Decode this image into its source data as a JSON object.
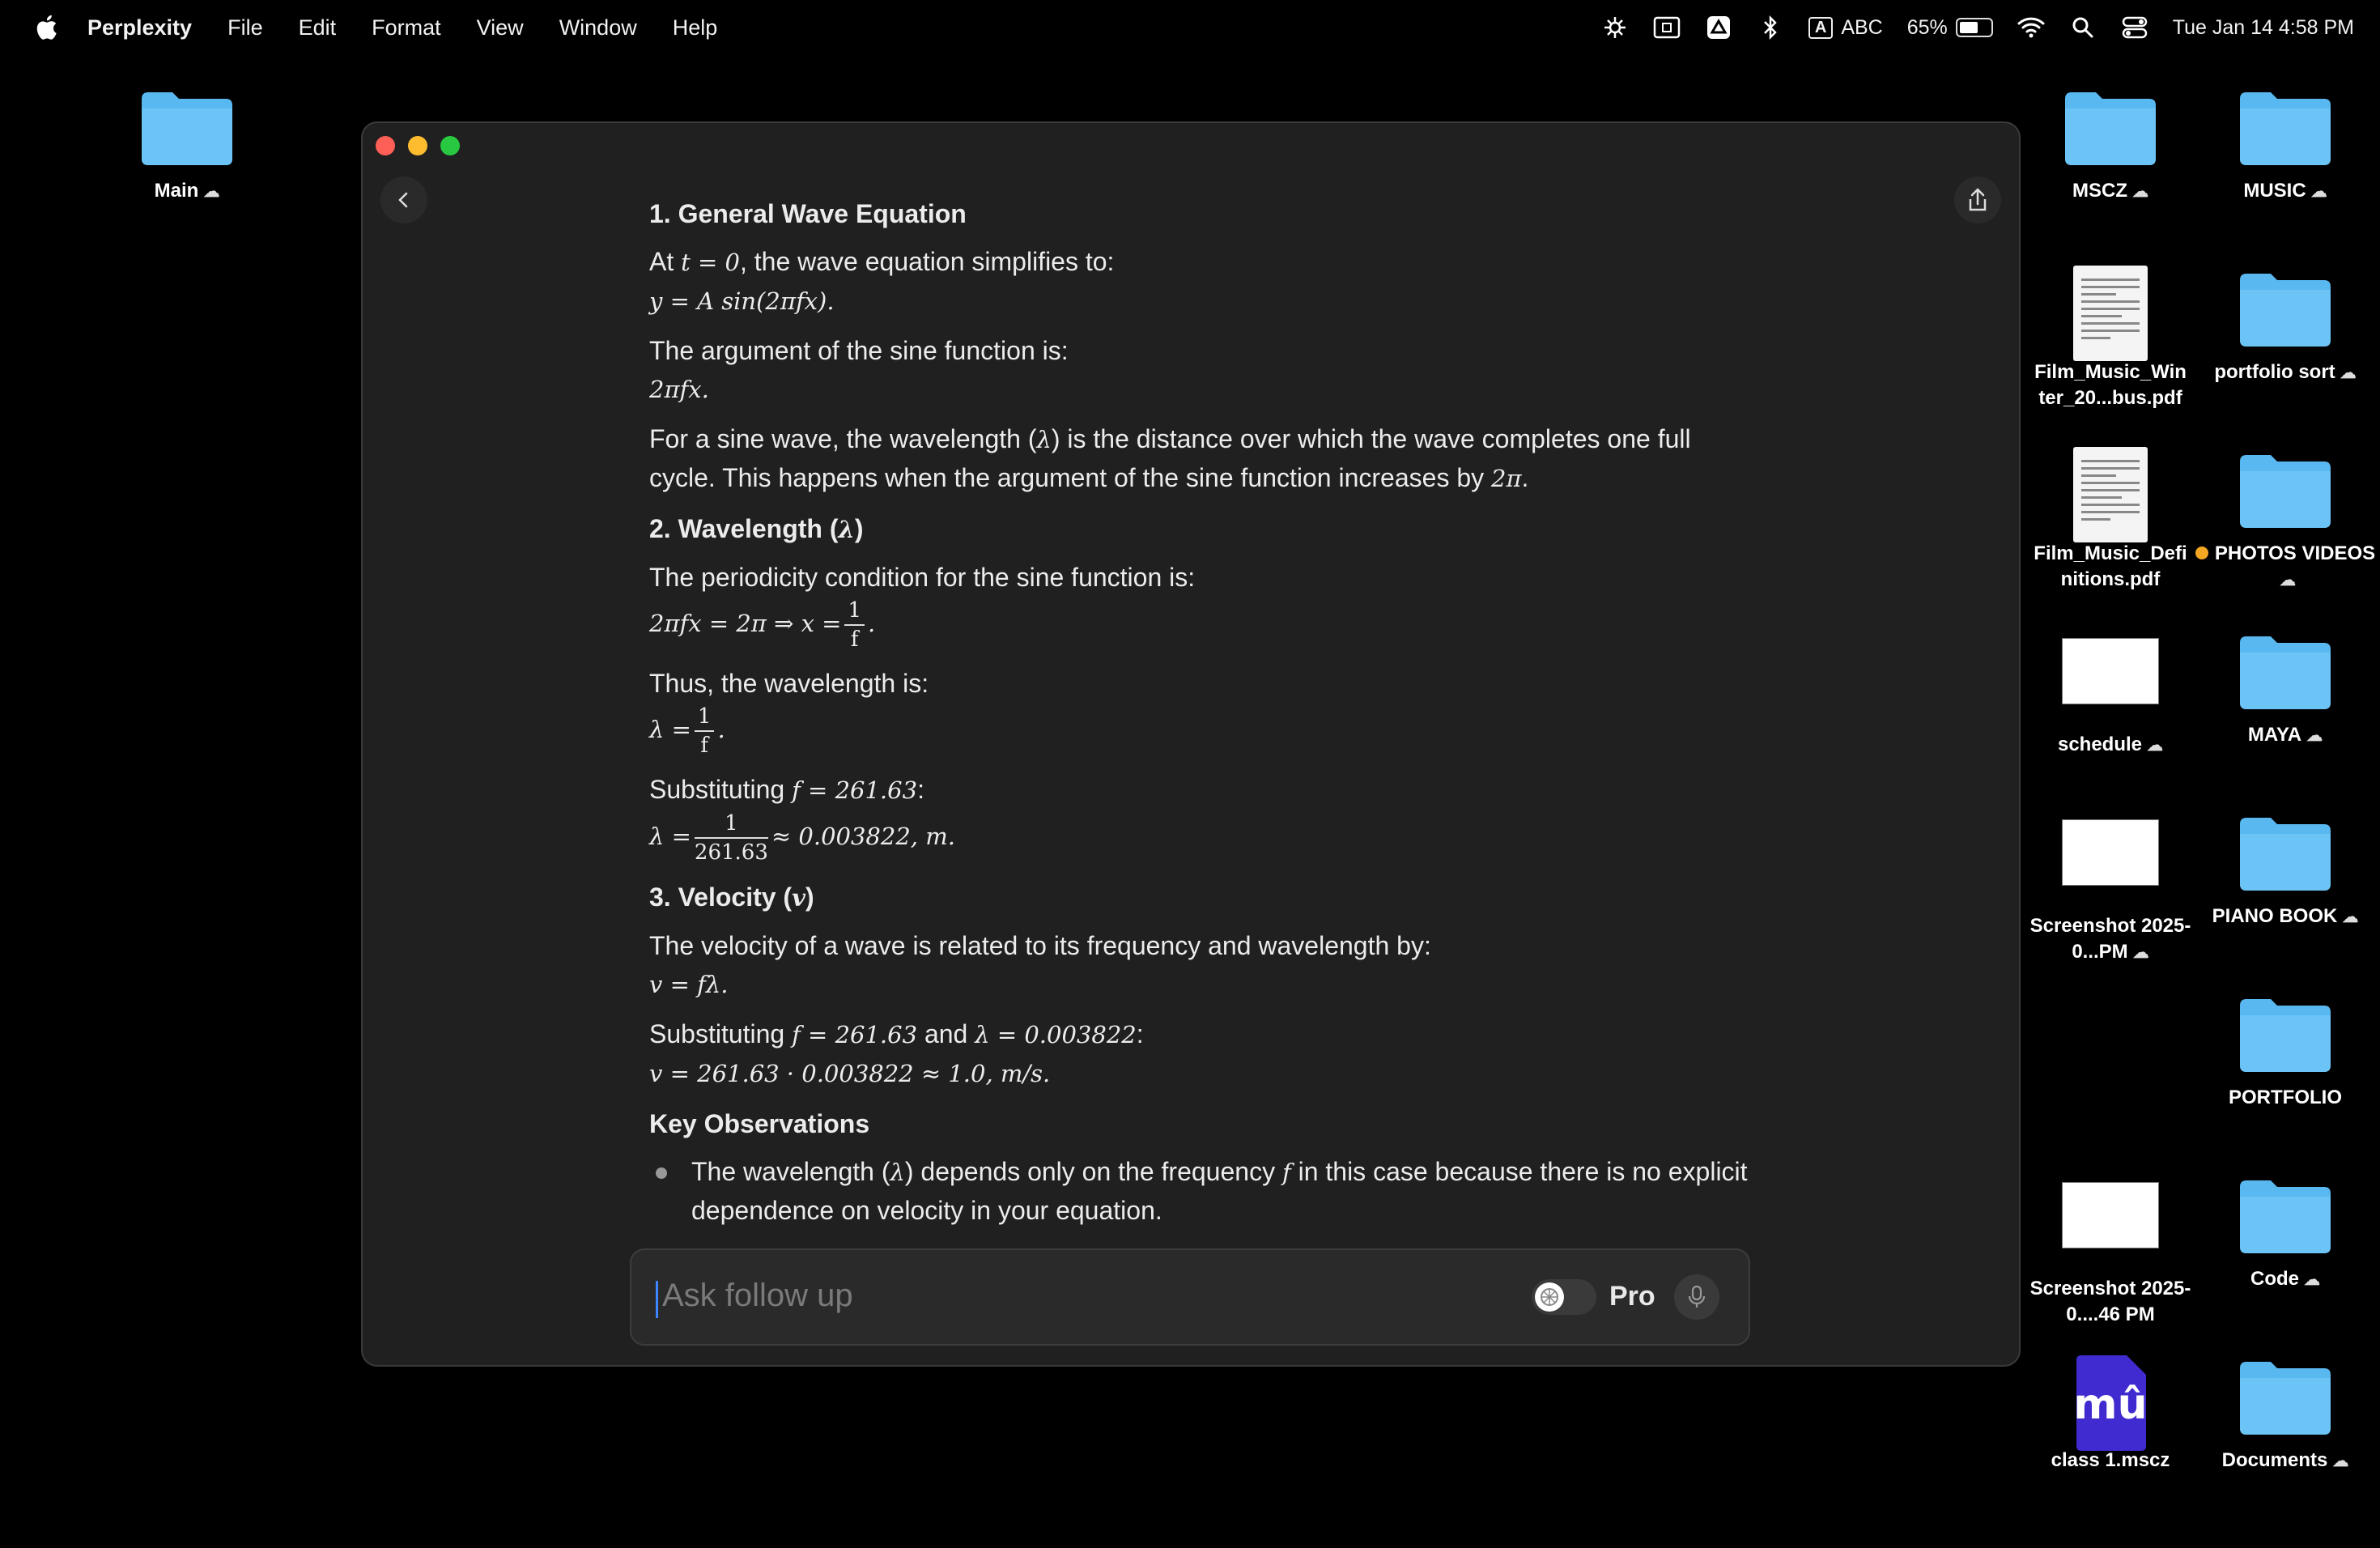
{
  "menubar": {
    "app_name": "Perplexity",
    "menus": [
      "File",
      "Edit",
      "Format",
      "View",
      "Window",
      "Help"
    ],
    "input_label": "ABC",
    "input_badge": "A",
    "battery_percent": "65%",
    "battery_level": 0.65,
    "clock": "Tue Jan 14  4:58 PM"
  },
  "desktop": {
    "left_icons": [
      {
        "label": "Main",
        "type": "folder",
        "cloud": true
      }
    ],
    "right_icons": [
      {
        "label": "MSCZ",
        "type": "folder",
        "cloud": true
      },
      {
        "label": "MUSIC",
        "type": "folder",
        "cloud": true
      },
      {
        "label": "Film_Music_Win ter_20...bus.pdf",
        "type": "pdf"
      },
      {
        "label": "portfolio sort",
        "type": "folder",
        "cloud": true
      },
      {
        "label": "Film_Music_Defi nitions.pdf",
        "type": "pdf"
      },
      {
        "label": "PHOTOS VIDEOS",
        "type": "folder",
        "cloud": true,
        "tag_color": "#f5a623"
      },
      {
        "label": "schedule",
        "type": "image",
        "cloud": true
      },
      {
        "label": "MAYA",
        "type": "folder",
        "cloud": true
      },
      {
        "label": "Screenshot 2025-0...PM",
        "type": "image",
        "cloud": true
      },
      {
        "label": "PIANO BOOK",
        "type": "folder",
        "cloud": true
      },
      {
        "label": "PORTFOLIO",
        "type": "folder"
      },
      {
        "label": "Screenshot 2025-0....46 PM",
        "type": "image"
      },
      {
        "label": "Code",
        "type": "folder",
        "cloud": true
      },
      {
        "label": "class 1.mscz",
        "type": "musescore"
      },
      {
        "label": "Documents",
        "type": "folder",
        "cloud": true
      }
    ]
  },
  "answer": {
    "s1_title": "1. General Wave Equation",
    "s1_p1_pre": "At",
    "s1_p1_math": "t = 0",
    "s1_p1_post": ", the wave equation simplifies to:",
    "s1_eq1": "y = A sin(2πfx).",
    "s1_p2": "The argument of the sine function is:",
    "s1_eq2": "2πfx.",
    "s1_p3_pre": "For a sine wave, the wavelength (",
    "s1_p3_lambda": "λ",
    "s1_p3_post": ") is the distance over which the wave completes one full cycle. This happens when the argument of the sine function increases by",
    "s1_p3_math": "2π",
    "s1_p3_end": ".",
    "s2_title_pre": "2. Wavelength (",
    "s2_title_math": "λ",
    "s2_title_post": ")",
    "s2_p1": "The periodicity condition for the sine function is:",
    "s2_eq1_lhs": "2πfx = 2π    ⇒    x =",
    "s2_eq1_num": "1",
    "s2_eq1_den": "f",
    "s2_p2": "Thus, the wavelength is:",
    "s2_eq2_lhs": "λ =",
    "s2_eq2_num": "1",
    "s2_eq2_den": "f",
    "s2_p3_pre": "Substituting",
    "s2_p3_math": "f = 261.63",
    "s2_p3_post": ":",
    "s2_eq3_lhs": "λ =",
    "s2_eq3_num": "1",
    "s2_eq3_den": "261.63",
    "s2_eq3_rhs": "≈ 0.003822, m.",
    "s3_title_pre": "3. Velocity (",
    "s3_title_math": "v",
    "s3_title_post": ")",
    "s3_p1": "The velocity of a wave is related to its frequency and wavelength by:",
    "s3_eq1": "v = fλ.",
    "s3_p2_pre": "Substituting",
    "s3_p2_math1": "f = 261.63",
    "s3_p2_mid": "and",
    "s3_p2_math2": "λ = 0.003822",
    "s3_p2_post": ":",
    "s3_eq2": "v = 261.63 · 0.003822 ≈ 1.0, m/s.",
    "key_title": "Key Observations",
    "bullet1_pre": "The wavelength (",
    "bullet1_lambda": "λ",
    "bullet1_mid": ") depends only on the frequency",
    "bullet1_f": "f",
    "bullet1_post": "in this case because there is no explicit dependence on velocity in your equation."
  },
  "ask": {
    "placeholder": "Ask follow up",
    "pro_label": "Pro"
  },
  "colors": {
    "folder": "#5ab8f0",
    "close": "#fe5f57",
    "minimize": "#febc2e",
    "maximize": "#28c840",
    "musescore": "#3f2bd0"
  }
}
